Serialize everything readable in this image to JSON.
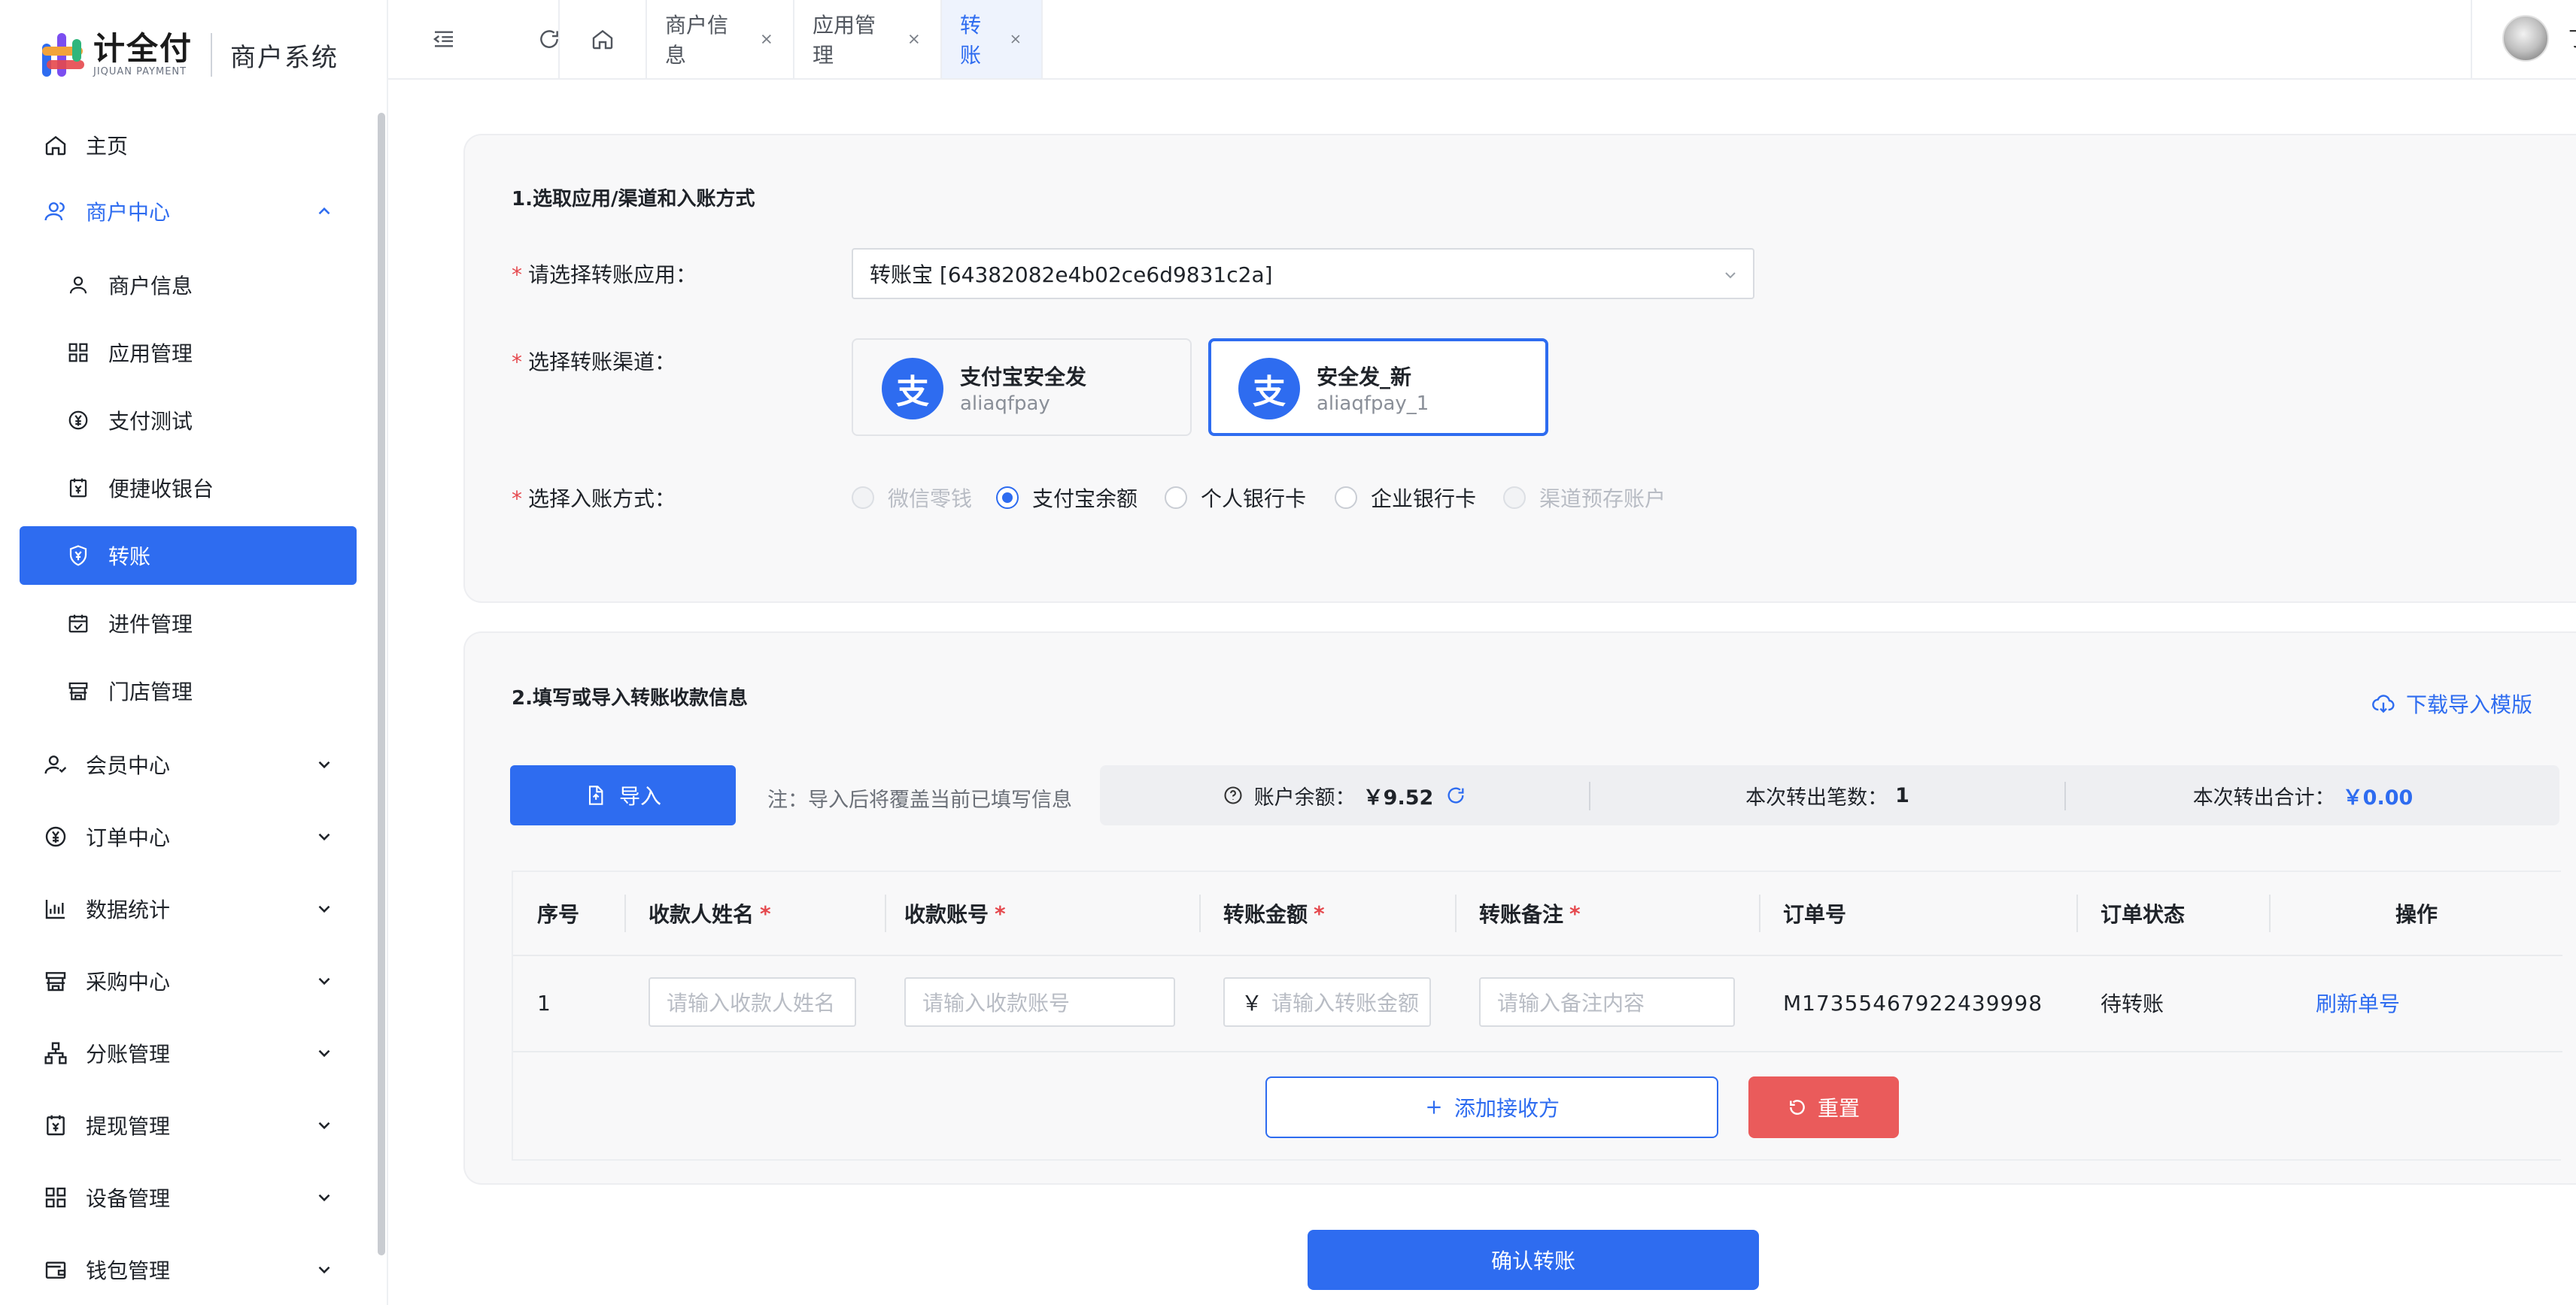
{
  "brand": {
    "name": "计全付",
    "sub": "JIQUAN PAYMENT",
    "system": "商户系统"
  },
  "sidebar": {
    "items": [
      {
        "label": "主页",
        "icon": "home-icon"
      },
      {
        "label": "商户中心",
        "icon": "merchant-icon"
      },
      {
        "label": "商户信息",
        "icon": "user-icon"
      },
      {
        "label": "应用管理",
        "icon": "grid-icon"
      },
      {
        "label": "支付测试",
        "icon": "yuan-circle-icon"
      },
      {
        "label": "便捷收银台",
        "icon": "cashier-icon"
      },
      {
        "label": "转账",
        "icon": "shield-yuan-icon"
      },
      {
        "label": "进件管理",
        "icon": "calendar-check-icon"
      },
      {
        "label": "门店管理",
        "icon": "store-icon"
      },
      {
        "label": "会员中心",
        "icon": "member-icon"
      },
      {
        "label": "订单中心",
        "icon": "order-icon"
      },
      {
        "label": "数据统计",
        "icon": "bar-chart-icon"
      },
      {
        "label": "采购中心",
        "icon": "purchase-icon"
      },
      {
        "label": "分账管理",
        "icon": "org-tree-icon"
      },
      {
        "label": "提现管理",
        "icon": "withdraw-icon"
      },
      {
        "label": "设备管理",
        "icon": "device-grid-icon"
      },
      {
        "label": "钱包管理",
        "icon": "wallet-icon"
      }
    ]
  },
  "topbar": {
    "tabs": [
      {
        "label": "商户信息"
      },
      {
        "label": "应用管理"
      },
      {
        "label": "转账"
      }
    ],
    "user_name": "丁"
  },
  "section1": {
    "title": "1.选取应用/渠道和入账方式",
    "app_label": "请选择转账应用：",
    "app_value": "转账宝 [64382082e4b02ce6d9831c2a]",
    "channel_label": "选择转账渠道：",
    "channels": [
      {
        "name": "支付宝安全发",
        "code": "aliaqfpay",
        "icon_char": "支"
      },
      {
        "name": "安全发_新",
        "code": "aliaqfpay_1",
        "icon_char": "支"
      }
    ],
    "method_label": "选择入账方式：",
    "methods": [
      {
        "label": "微信零钱"
      },
      {
        "label": "支付宝余额"
      },
      {
        "label": "个人银行卡"
      },
      {
        "label": "企业银行卡"
      },
      {
        "label": "渠道预存账户"
      }
    ]
  },
  "section2": {
    "title": "2.填写或导入转账收款信息",
    "download_label": "下载导入模版",
    "import_label": "导入",
    "import_note": "注：导入后将覆盖当前已填写信息",
    "balance_label": "账户余额：",
    "balance_value": "￥9.52",
    "count_label": "本次转出笔数：",
    "count_value": "1",
    "total_label": "本次转出合计：",
    "total_value": "￥0.00",
    "table": {
      "headers": [
        "序号",
        "收款人姓名",
        "收款账号",
        "转账金额",
        "转账备注",
        "订单号",
        "订单状态",
        "操作"
      ],
      "required_mark": "*",
      "row": {
        "index": "1",
        "name_placeholder": "请输入收款人姓名",
        "account_placeholder": "请输入收款账号",
        "amount_prefix": "￥",
        "amount_placeholder": "请输入转账金额",
        "remark_placeholder": "请输入备注内容",
        "order_no": "M17355467922439998",
        "status": "待转账",
        "action": "刷新单号"
      }
    },
    "add_label": "添加接收方",
    "reset_label": "重置"
  },
  "confirm_label": "确认转账",
  "colors": {
    "primary": "#2e6cf0",
    "danger": "#ea5b5b"
  }
}
